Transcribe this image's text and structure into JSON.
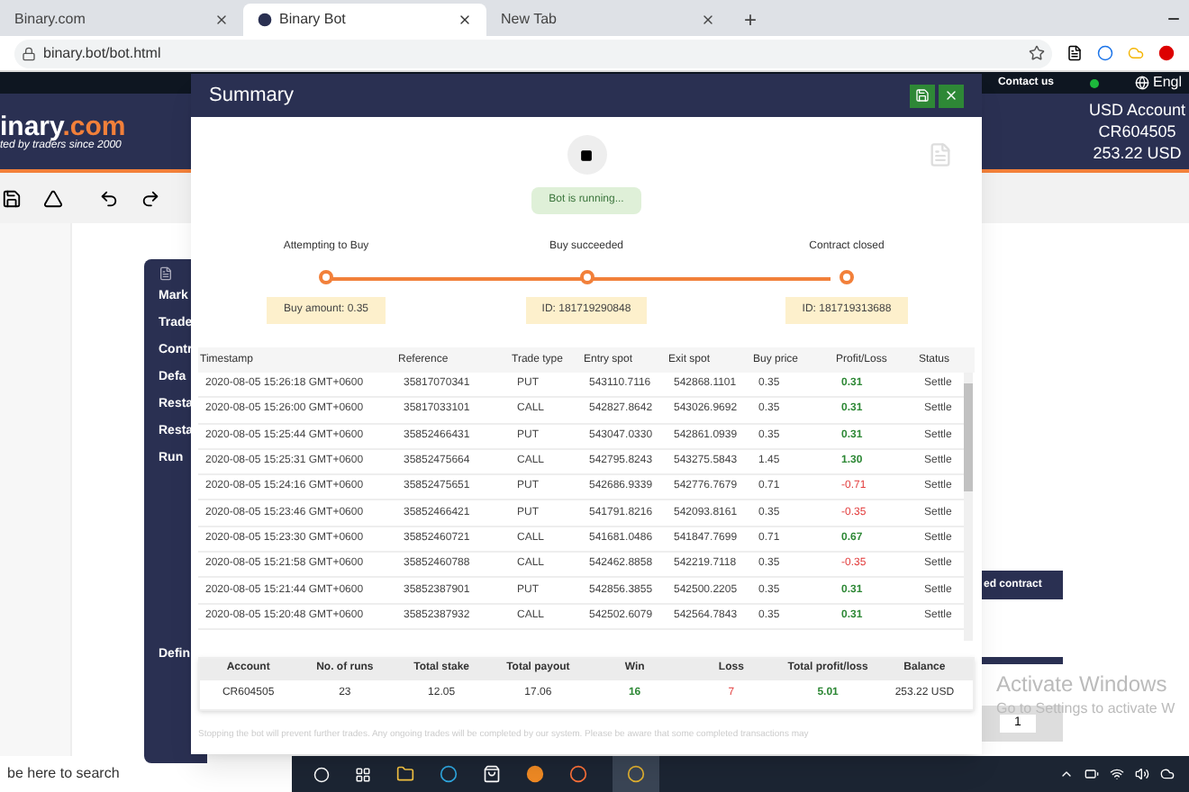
{
  "browser": {
    "tabs": [
      {
        "label": "Binary.com",
        "selected": false
      },
      {
        "label": "Binary Bot",
        "selected": true
      },
      {
        "label": "New Tab",
        "selected": false
      }
    ],
    "new_tab": "+",
    "url": "binary.bot/bot.html"
  },
  "site": {
    "contact": "Contact us",
    "language": "Engl",
    "logo_name": "inary",
    "logo_suffix": ".com",
    "tagline": "ted by traders since 2000",
    "account_type": "USD Account",
    "account_id": "CR604505",
    "balance": "253.22 USD"
  },
  "workspace": {
    "block_labels": [
      "Mark",
      "Trade",
      "Contr",
      "Defa",
      "Resta",
      "Resta",
      "Run"
    ],
    "lower_label": "Defin",
    "side_button": "ed contract",
    "page_field": "1"
  },
  "summary": {
    "title": "Summary",
    "status": "Bot is running...",
    "steps": [
      {
        "label": "Attempting to Buy",
        "note": "Buy amount: 0.35"
      },
      {
        "label": "Buy succeeded",
        "note": "ID: 181719290848"
      },
      {
        "label": "Contract closed",
        "note": "ID: 181719313688"
      }
    ],
    "columns": [
      "Timestamp",
      "Reference",
      "Trade type",
      "Entry spot",
      "Exit spot",
      "Buy price",
      "Profit/Loss",
      "Status"
    ],
    "rows": [
      {
        "cells": [
          "2020-08-05 15:26:18 GMT+0600",
          "35817070341",
          "PUT",
          "543110.7116",
          "542868.1101",
          "0.35",
          "0.31",
          "Settle"
        ],
        "loss": false
      },
      {
        "cells": [
          "2020-08-05 15:26:00 GMT+0600",
          "35817033101",
          "CALL",
          "542827.8642",
          "543026.9692",
          "0.35",
          "0.31",
          "Settle"
        ],
        "loss": false
      },
      {
        "cells": [
          "2020-08-05 15:25:44 GMT+0600",
          "35852466431",
          "PUT",
          "543047.0330",
          "542861.0939",
          "0.35",
          "0.31",
          "Settle"
        ],
        "loss": false
      },
      {
        "cells": [
          "2020-08-05 15:25:31 GMT+0600",
          "35852475664",
          "CALL",
          "542795.8243",
          "543275.5843",
          "1.45",
          "1.30",
          "Settle"
        ],
        "loss": false
      },
      {
        "cells": [
          "2020-08-05 15:24:16 GMT+0600",
          "35852475651",
          "PUT",
          "542686.9339",
          "542776.7679",
          "0.71",
          "-0.71",
          "Settle"
        ],
        "loss": true
      },
      {
        "cells": [
          "2020-08-05 15:23:46 GMT+0600",
          "35852466421",
          "PUT",
          "541791.8216",
          "542093.8161",
          "0.35",
          "-0.35",
          "Settle"
        ],
        "loss": true
      },
      {
        "cells": [
          "2020-08-05 15:23:30 GMT+0600",
          "35852460721",
          "CALL",
          "541681.0486",
          "541847.7699",
          "0.71",
          "0.67",
          "Settle"
        ],
        "loss": false
      },
      {
        "cells": [
          "2020-08-05 15:21:58 GMT+0600",
          "35852460788",
          "CALL",
          "542462.8858",
          "542219.7118",
          "0.35",
          "-0.35",
          "Settle"
        ],
        "loss": true
      },
      {
        "cells": [
          "2020-08-05 15:21:44 GMT+0600",
          "35852387901",
          "PUT",
          "542856.3855",
          "542500.2205",
          "0.35",
          "0.31",
          "Settle"
        ],
        "loss": false
      },
      {
        "cells": [
          "2020-08-05 15:20:48 GMT+0600",
          "35852387932",
          "CALL",
          "542502.6079",
          "542564.7843",
          "0.35",
          "0.31",
          "Settle"
        ],
        "loss": false
      }
    ],
    "totals": [
      {
        "label": "Account",
        "value": "CR604505",
        "kind": "plain"
      },
      {
        "label": "No. of runs",
        "value": "23",
        "kind": "plain"
      },
      {
        "label": "Total stake",
        "value": "12.05",
        "kind": "plain"
      },
      {
        "label": "Total payout",
        "value": "17.06",
        "kind": "plain"
      },
      {
        "label": "Win",
        "value": "16",
        "kind": "win"
      },
      {
        "label": "Loss",
        "value": "7",
        "kind": "loss"
      },
      {
        "label": "Total profit/loss",
        "value": "5.01",
        "kind": "win"
      },
      {
        "label": "Balance",
        "value": "253.22 USD",
        "kind": "plain"
      }
    ],
    "footer": "Stopping the bot will prevent further trades. Any ongoing trades will be completed by our system. Please be aware that some completed transactions may"
  },
  "os": {
    "activate_title": "Activate Windows",
    "activate_hint": "Go to Settings to activate W",
    "search_placeholder": "be here to search"
  }
}
